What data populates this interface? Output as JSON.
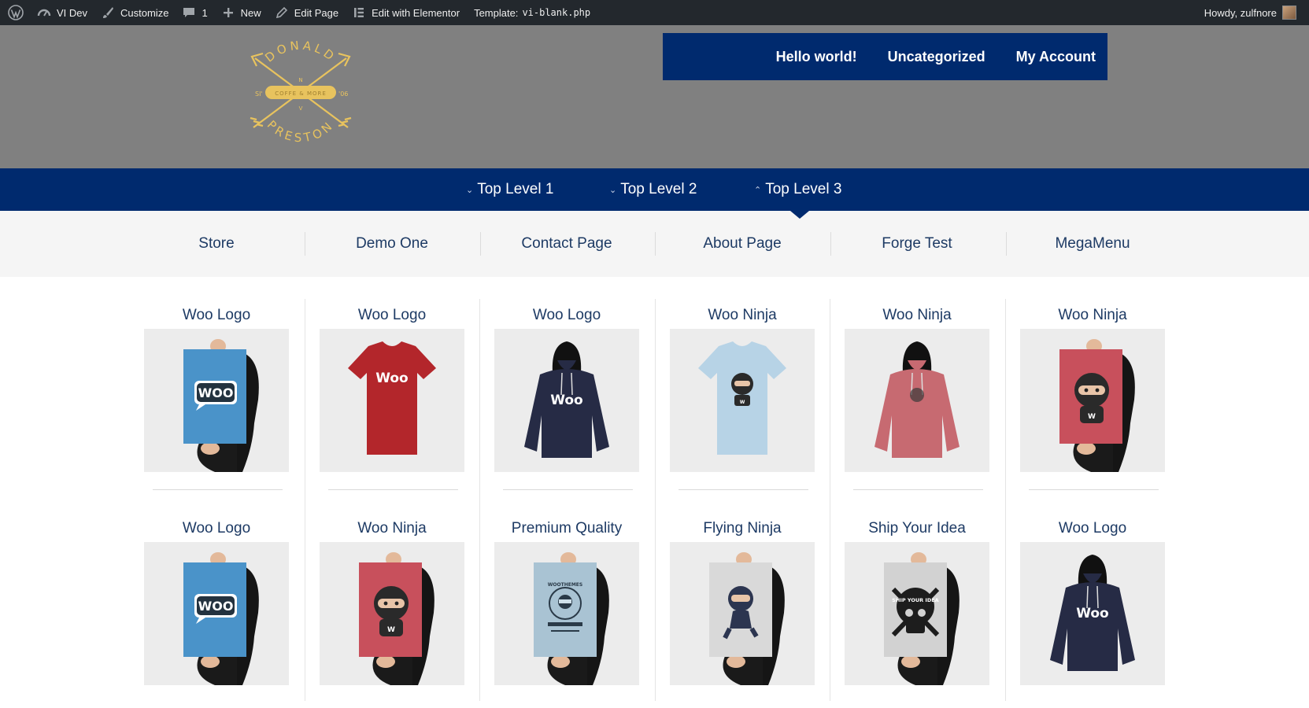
{
  "admin_bar": {
    "site_name": "VI Dev",
    "customize": "Customize",
    "comments_count": "1",
    "new": "New",
    "edit_page": "Edit Page",
    "edit_elementor": "Edit with Elementor",
    "template_label": "Template:",
    "template_file": "vi-blank.php",
    "howdy": "Howdy, zulfnore"
  },
  "logo": {
    "top_text": "DONALD",
    "bottom_text": "PRESTON",
    "banner_text": "COFFE & MORE",
    "left_text": "SI'",
    "right_text": "'06",
    "m_letter": "N",
    "v_letter": "V",
    "color": "#e8c35e"
  },
  "top_nav": [
    "Hello world!",
    "Uncategorized",
    "My Account"
  ],
  "main_nav": [
    {
      "label": "Top Level 1",
      "caret": "⌄"
    },
    {
      "label": "Top Level 2",
      "caret": "⌄"
    },
    {
      "label": "Top Level 3",
      "caret": "⌃"
    }
  ],
  "sub_menu": [
    "Store",
    "Demo One",
    "Contact Page",
    "About Page",
    "Forge Test",
    "MegaMenu"
  ],
  "products_row1": [
    {
      "title": "Woo Logo",
      "kind": "poster-blue"
    },
    {
      "title": "Woo Logo",
      "kind": "tshirt-red"
    },
    {
      "title": "Woo Logo",
      "kind": "hoodie-navy"
    },
    {
      "title": "Woo Ninja",
      "kind": "tshirt-lightblue"
    },
    {
      "title": "Woo Ninja",
      "kind": "hoodie-pink"
    },
    {
      "title": "Woo Ninja",
      "kind": "poster-red-ninja"
    }
  ],
  "products_row2": [
    {
      "title": "Woo Logo",
      "kind": "poster-blue"
    },
    {
      "title": "Woo Ninja",
      "kind": "poster-red-ninja"
    },
    {
      "title": "Premium Quality",
      "kind": "poster-lightblue"
    },
    {
      "title": "Flying Ninja",
      "kind": "poster-grey-ninja"
    },
    {
      "title": "Ship Your Idea",
      "kind": "poster-skull"
    },
    {
      "title": "Woo Logo",
      "kind": "hoodie-navy"
    }
  ],
  "product_image_text": {
    "woo": "Woo",
    "woo_upper": "WOO",
    "woothemes": "WOOTHEMES",
    "ship_your_idea": "SHIP YOUR IDEA",
    "w": "W"
  },
  "colors": {
    "admin_bar": "#23282d",
    "header": "#808080",
    "nav_blue": "#002a6e",
    "submenu_bg": "#f5f5f5",
    "title_color": "#1d3a64"
  }
}
